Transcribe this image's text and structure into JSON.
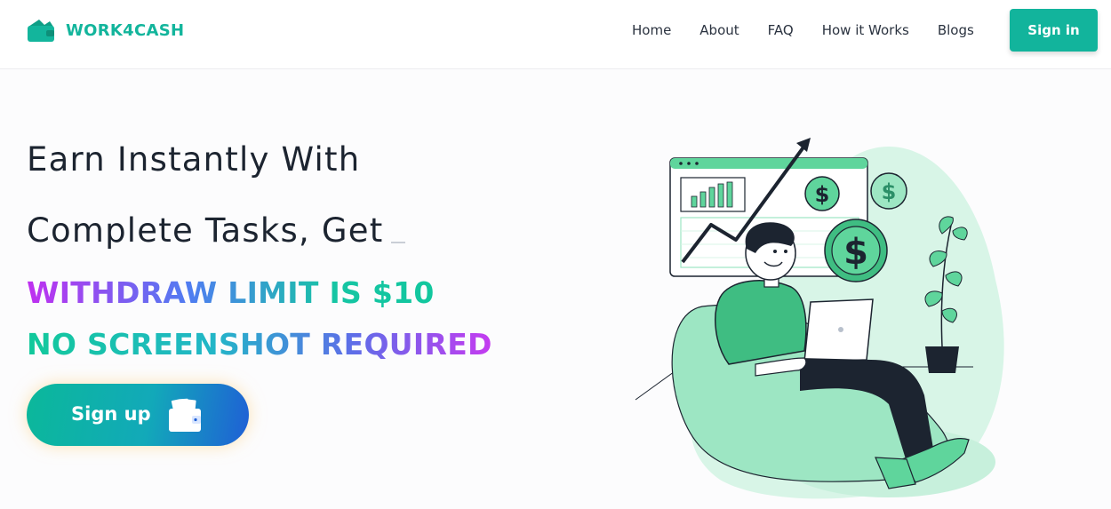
{
  "brand": {
    "name": "WORK4CASH",
    "accent": "#13b59c"
  },
  "nav": {
    "items": [
      {
        "label": "Home"
      },
      {
        "label": "About"
      },
      {
        "label": "FAQ"
      },
      {
        "label": "How it Works"
      },
      {
        "label": "Blogs"
      }
    ],
    "signin_label": "Sign in"
  },
  "hero": {
    "line1": "Earn Instantly With",
    "line2": "Complete Tasks, Get",
    "highlight1": "WITHDRAW LIMIT IS $10",
    "highlight2": "NO SCREENSHOT REQUIRED",
    "signup_label": "Sign up",
    "signup_icon": "wallet-icon"
  },
  "illustration": {
    "subject": "man-with-laptop-on-beanbag",
    "icons": [
      "dollar-coin-icon",
      "bar-chart-icon",
      "trend-arrow-icon",
      "potted-plant-icon"
    ]
  }
}
